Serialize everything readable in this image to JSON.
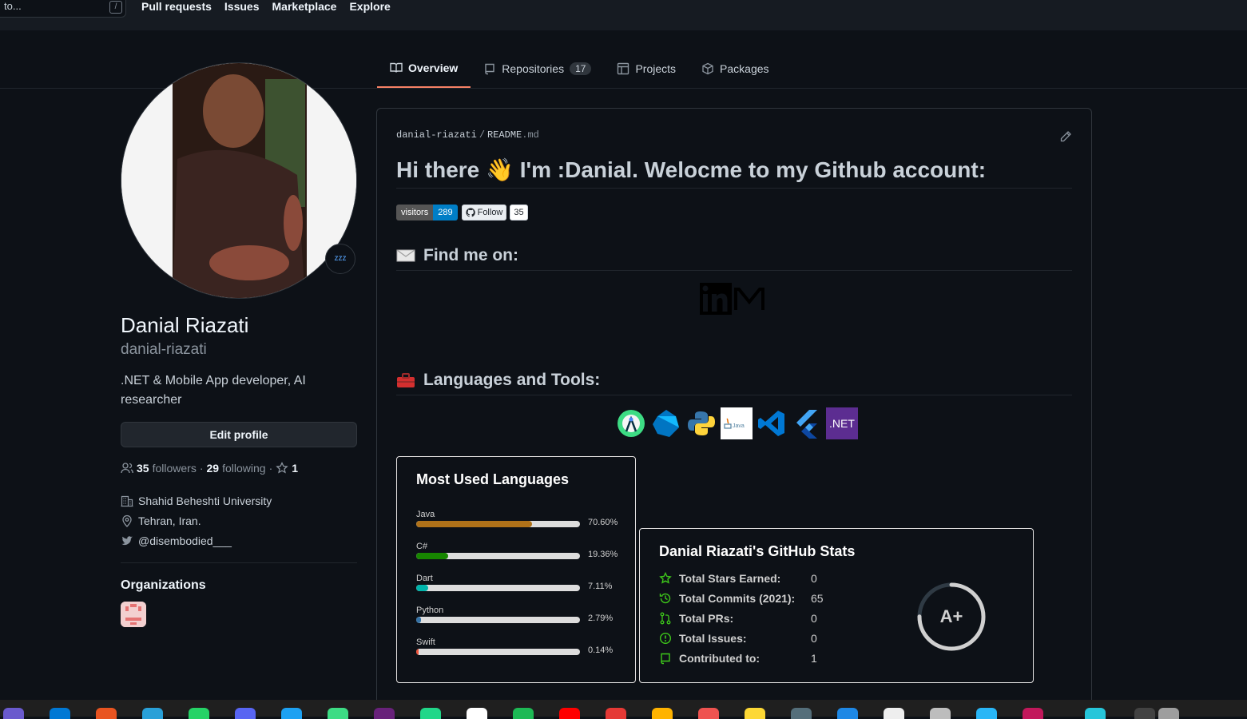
{
  "topbar": {
    "search_placeholder": "to...",
    "search_key": "/",
    "nav": [
      "Pull requests",
      "Issues",
      "Marketplace",
      "Explore"
    ]
  },
  "tabs": [
    {
      "label": "Overview",
      "icon": "book-icon",
      "active": true
    },
    {
      "label": "Repositories",
      "icon": "repo-icon",
      "count": "17"
    },
    {
      "label": "Projects",
      "icon": "project-icon"
    },
    {
      "label": "Packages",
      "icon": "package-icon"
    }
  ],
  "profile": {
    "status_emoji": "zzz",
    "name": "Danial Riazati",
    "login": "danial-riazati",
    "bio": ".NET & Mobile App developer, AI researcher",
    "edit_label": "Edit profile",
    "followers": "35",
    "followers_label": "followers",
    "following": "29",
    "following_label": "following",
    "stars": "1",
    "company": "Shahid Beheshti University",
    "location": "Tehran, Iran.",
    "twitter": "@disembodied___",
    "orgs_title": "Organizations"
  },
  "readme": {
    "owner": "danial-riazati",
    "file": "README",
    "ext": ".md",
    "heading_a": "Hi there",
    "heading_emoji": "👋",
    "heading_b": "I'm :Danial. Welocme to my Github account:",
    "visitors_label": "visitors",
    "visitors_count": "289",
    "follow_label": "Follow",
    "follow_count": "35",
    "find_me": "Find me on:",
    "langs_tools": "Languages and Tools:",
    "tool_icons": [
      "android-studio-icon",
      "dart-icon",
      "python-icon",
      "java-icon",
      "vscode-icon",
      "flutter-icon",
      "dotnet-icon"
    ],
    "dotnet_text": ".NET",
    "java_text": "Java"
  },
  "langs_card": {
    "title": "Most Used Languages",
    "langs": [
      {
        "name": "Java",
        "pct": "70.60%",
        "value": 70.6,
        "color": "#b07219"
      },
      {
        "name": "C#",
        "pct": "19.36%",
        "value": 19.36,
        "color": "#178600"
      },
      {
        "name": "Dart",
        "pct": "7.11%",
        "value": 7.11,
        "color": "#00B4AB"
      },
      {
        "name": "Python",
        "pct": "2.79%",
        "value": 2.79,
        "color": "#3572A5"
      },
      {
        "name": "Swift",
        "pct": "0.14%",
        "value": 0.14,
        "color": "#F05138"
      }
    ]
  },
  "stats_card": {
    "title": "Danial Riazati's GitHub Stats",
    "rows": [
      {
        "label": "Total Stars Earned:",
        "value": "0",
        "icon": "star-icon"
      },
      {
        "label": "Total Commits (2021):",
        "value": "65",
        "icon": "history-icon"
      },
      {
        "label": "Total PRs:",
        "value": "0",
        "icon": "pull-request-icon"
      },
      {
        "label": "Total Issues:",
        "value": "0",
        "icon": "issue-icon"
      },
      {
        "label": "Contributed to:",
        "value": "1",
        "icon": "repo-icon"
      }
    ],
    "grade": "A+",
    "grade_progress": 0.75,
    "accent": "#2f80ed",
    "icon_color": "#3ec91a"
  }
}
